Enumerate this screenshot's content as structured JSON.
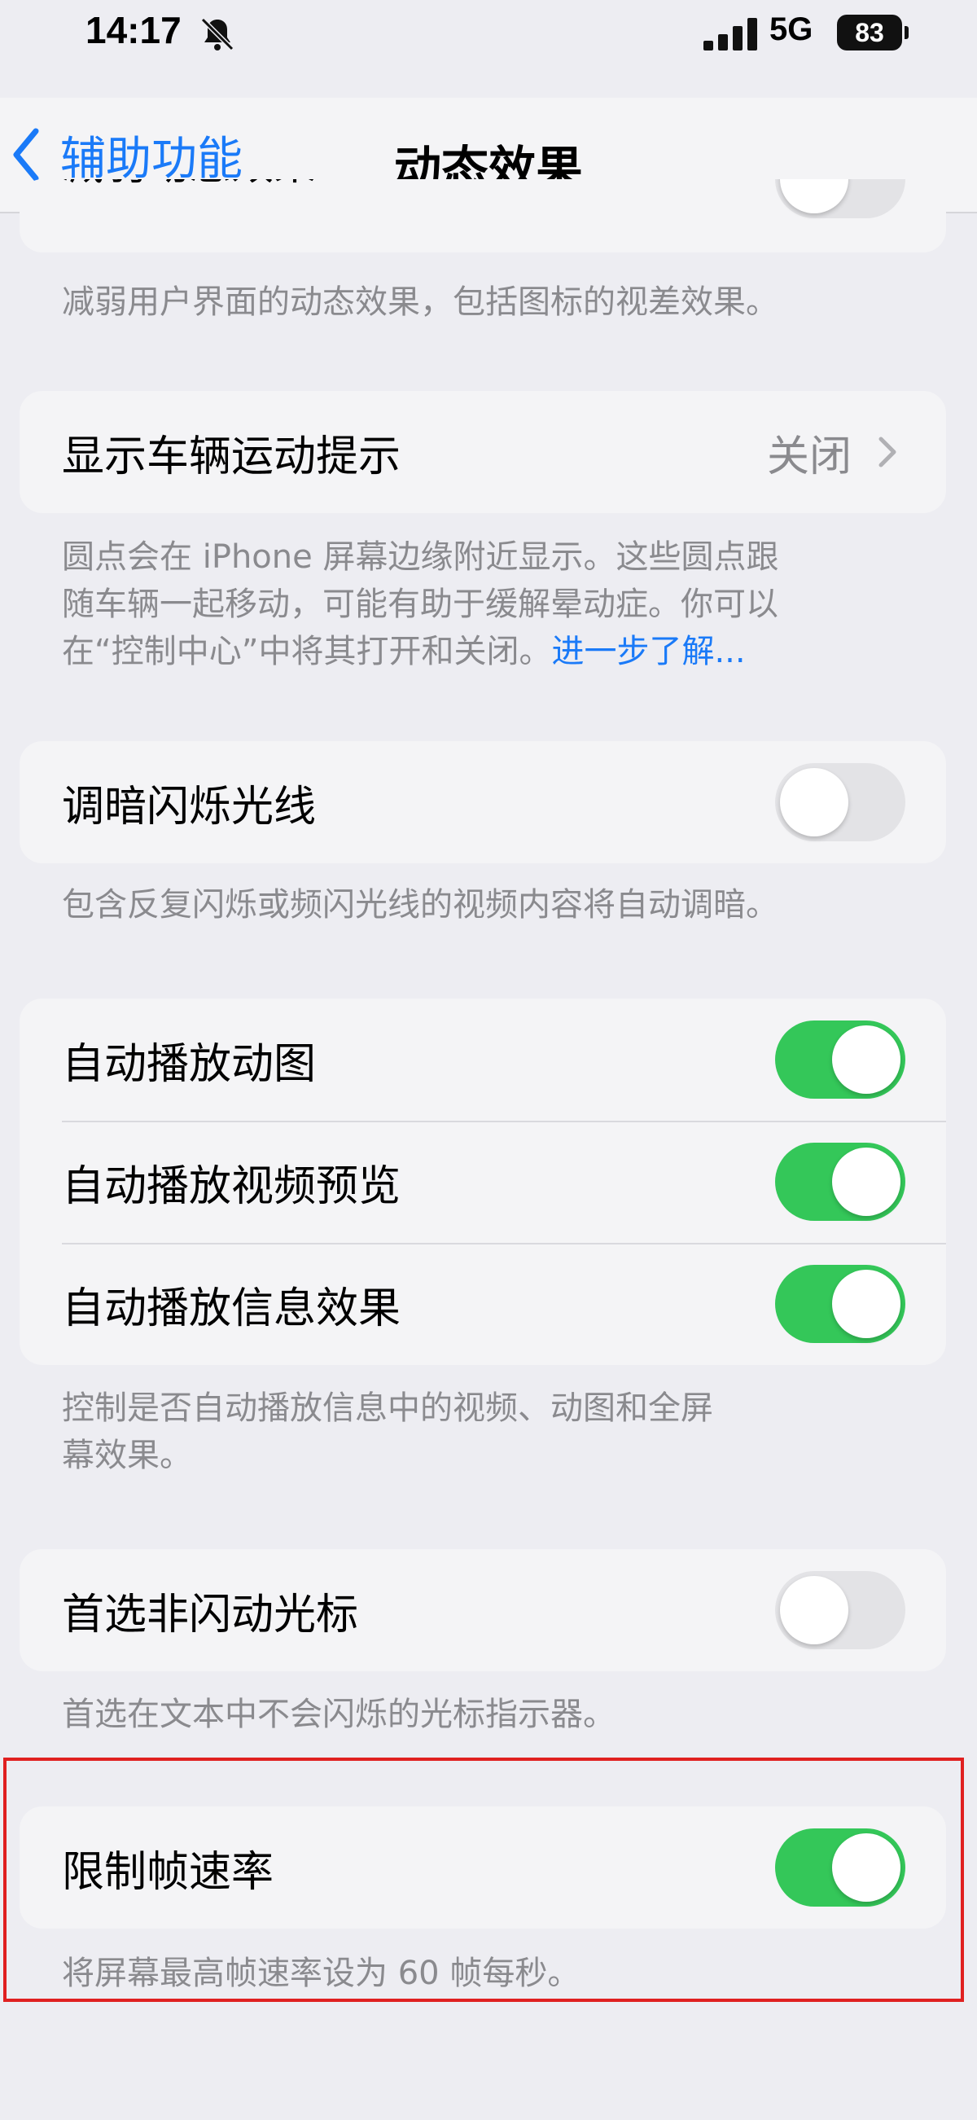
{
  "status_bar": {
    "time": "14:17",
    "bell_icon": "bell-slash-icon",
    "signal_icon": "cellular-signal-icon",
    "network": "5G",
    "battery": "83"
  },
  "nav": {
    "back_label": "辅助功能",
    "title": "动态效果"
  },
  "reduce_motion": {
    "label": "减弱动态效果",
    "toggle_on": false,
    "footer": "减弱用户界面的动态效果，包括图标的视差效果。"
  },
  "vehicle_motion_cues": {
    "label": "显示车辆运动提示",
    "value": "关闭",
    "footer_line1": "圆点会在 iPhone 屏幕边缘附近显示。这些圆点跟",
    "footer_line2": "随车辆一起移动，可能有助于缓解晕动症。你可以",
    "footer_line3": "在“控制中心”中将其打开和关闭。",
    "learn_more": "进一步了解..."
  },
  "dim_flashing_lights": {
    "label": "调暗闪烁光线",
    "toggle_on": false,
    "footer": "包含反复闪烁或频闪光线的视频内容将自动调暗。"
  },
  "autoplay": {
    "rows": [
      {
        "label": "自动播放动图",
        "toggle_on": true
      },
      {
        "label": "自动播放视频预览",
        "toggle_on": true
      },
      {
        "label": "自动播放信息效果",
        "toggle_on": true
      }
    ],
    "footer_line1": "控制是否自动播放信息中的视频、动图和全屏",
    "footer_line2": "幕效果。"
  },
  "non_blinking_cursor": {
    "label": "首选非闪动光标",
    "toggle_on": false,
    "footer": "首选在文本中不会闪烁的光标指示器。"
  },
  "limit_frame_rate": {
    "label": "限制帧速率",
    "toggle_on": true,
    "footer": "将屏幕最高帧速率设为 60 帧每秒。"
  },
  "colors": {
    "background": "#ededf2",
    "card": "#f4f4f6",
    "accent_blue": "#1a7af8",
    "toggle_green": "#34c759",
    "highlight_red": "#e02020"
  }
}
